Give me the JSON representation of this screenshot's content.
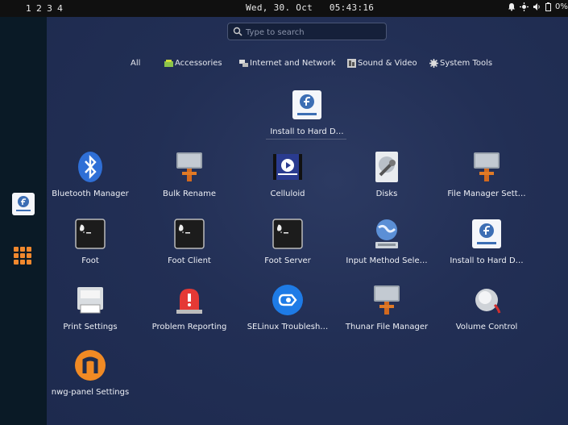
{
  "topbar": {
    "workspaces": [
      "1",
      "2",
      "3",
      "4"
    ],
    "clock": "Wed, 30. Oct   05:43:16",
    "battery": "0%"
  },
  "search": {
    "placeholder": "Type to search"
  },
  "categories": [
    "All",
    "Accessories",
    "Internet and Network",
    "Sound & Video",
    "System Tools"
  ],
  "featured": {
    "label": "Install to Hard D…",
    "icon": "fedora-installer-icon"
  },
  "apps": [
    {
      "label": "Bluetooth Manager",
      "icon": "bluetooth-icon"
    },
    {
      "label": "Bulk Rename",
      "icon": "thunar-icon"
    },
    {
      "label": "Celluloid",
      "icon": "celluloid-icon"
    },
    {
      "label": "Disks",
      "icon": "disks-icon"
    },
    {
      "label": "File Manager Sett…",
      "icon": "thunar-icon"
    },
    {
      "label": "Foot",
      "icon": "foot-terminal-icon"
    },
    {
      "label": "Foot Client",
      "icon": "foot-terminal-icon"
    },
    {
      "label": "Foot Server",
      "icon": "foot-terminal-icon"
    },
    {
      "label": "Input Method Sele…",
      "icon": "globe-icon"
    },
    {
      "label": "Install to Hard D…",
      "icon": "fedora-installer-icon"
    },
    {
      "label": "Print Settings",
      "icon": "printer-icon"
    },
    {
      "label": "Problem Reporting",
      "icon": "alarm-icon"
    },
    {
      "label": "SELinux Troublesh…",
      "icon": "selinux-icon"
    },
    {
      "label": "Thunar File Manager",
      "icon": "thunar-icon"
    },
    {
      "label": "Volume Control",
      "icon": "volume-knob-icon"
    },
    {
      "label": "nwg-panel Settings",
      "icon": "nwg-icon"
    }
  ],
  "colors": {
    "accent": "#f0882e",
    "background": "#1e2d4f",
    "topbar": "#101010"
  }
}
